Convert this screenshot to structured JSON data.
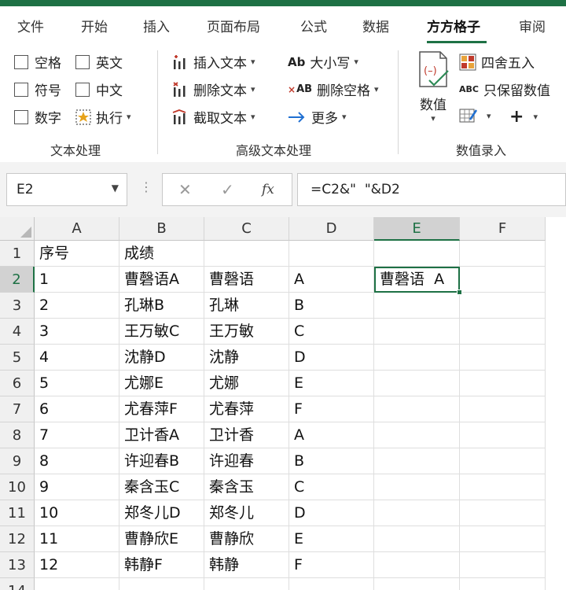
{
  "ribbon_tabs": [
    {
      "label": "文件",
      "active": false
    },
    {
      "label": "开始",
      "active": false
    },
    {
      "label": "插入",
      "active": false
    },
    {
      "label": "页面布局",
      "active": false
    },
    {
      "label": "公式",
      "active": false
    },
    {
      "label": "数据",
      "active": false
    },
    {
      "label": "方方格子",
      "active": true
    },
    {
      "label": "审阅",
      "active": false
    }
  ],
  "text_group": {
    "label": "文本处理",
    "checkboxes": [
      "空格",
      "英文",
      "符号",
      "中文",
      "数字"
    ],
    "execute_label": "执行"
  },
  "advanced_group": {
    "label": "高级文本处理",
    "insert_text": "插入文本",
    "delete_text": "删除文本",
    "extract_text": "截取文本",
    "case": "大小写",
    "delete_spaces": "删除空格",
    "more": "更多",
    "case_icon_text": "Ab",
    "del_space_icon_text": "AB"
  },
  "numeric_group": {
    "label": "数值录入",
    "value_label": "数值",
    "round": "四舍五入",
    "keep_values": "只保留数值",
    "keep_values_icon_text": "ABC"
  },
  "formula_bar": {
    "name_box": "E2",
    "formula": "=C2&\"  \"&D2",
    "fx": "fx"
  },
  "columns": [
    "A",
    "B",
    "C",
    "D",
    "E",
    "F"
  ],
  "selected_column": "E",
  "selected_row": "2",
  "rows": [
    {
      "num": "1",
      "cells": [
        "序号",
        "成绩",
        "",
        "",
        "",
        ""
      ]
    },
    {
      "num": "2",
      "cells": [
        "1",
        "曹磬语A",
        "曹磬语",
        "A",
        "曹磬语  A",
        ""
      ]
    },
    {
      "num": "3",
      "cells": [
        "2",
        "孔琳B",
        "孔琳",
        "B",
        "",
        ""
      ]
    },
    {
      "num": "4",
      "cells": [
        "3",
        "王万敏C",
        "王万敏",
        "C",
        "",
        ""
      ]
    },
    {
      "num": "5",
      "cells": [
        "4",
        "沈静D",
        "沈静",
        "D",
        "",
        ""
      ]
    },
    {
      "num": "6",
      "cells": [
        "5",
        "尤娜E",
        "尤娜",
        "E",
        "",
        ""
      ]
    },
    {
      "num": "7",
      "cells": [
        "6",
        "尤春萍F",
        "尤春萍",
        "F",
        "",
        ""
      ]
    },
    {
      "num": "8",
      "cells": [
        "7",
        "卫计香A",
        "卫计香",
        "A",
        "",
        ""
      ]
    },
    {
      "num": "9",
      "cells": [
        "8",
        "许迎春B",
        "许迎春",
        "B",
        "",
        ""
      ]
    },
    {
      "num": "10",
      "cells": [
        "9",
        "秦含玉C",
        "秦含玉",
        "C",
        "",
        ""
      ]
    },
    {
      "num": "11",
      "cells": [
        "10",
        "郑冬儿D",
        "郑冬儿",
        "D",
        "",
        ""
      ]
    },
    {
      "num": "12",
      "cells": [
        "11",
        "曹静欣E",
        "曹静欣",
        "E",
        "",
        ""
      ]
    },
    {
      "num": "13",
      "cells": [
        "12",
        "韩静F",
        "韩静",
        "F",
        "",
        ""
      ]
    },
    {
      "num": "14",
      "cells": [
        "",
        "",
        "",
        "",
        "",
        ""
      ]
    }
  ],
  "colors": {
    "accent": "#1e7145",
    "header_bg": "#f0f0f0",
    "selected_header_bg": "#d2d2d2",
    "arrow_blue": "#1f6fd1",
    "icon_red": "#c0392b"
  }
}
